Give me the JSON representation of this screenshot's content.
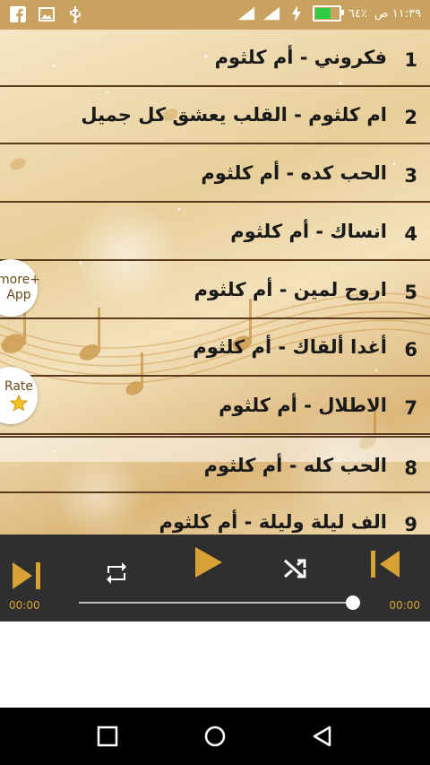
{
  "status_bar": {
    "time": "١١:٣٩ ص",
    "battery_text": "٦٤٪",
    "left_icons": [
      "facebook-icon",
      "image-icon",
      "usb-icon"
    ],
    "right_icons": [
      "signal-icon",
      "signal-icon",
      "charging-icon",
      "battery-icon"
    ]
  },
  "songs": [
    {
      "num": "1",
      "title": "فكروني - أم كلثوم"
    },
    {
      "num": "2",
      "title": "ام كلثوم - القلب يعشق كل جميل"
    },
    {
      "num": "3",
      "title": "الحب كده - أم كلثوم"
    },
    {
      "num": "4",
      "title": "انساك - أم كلثوم"
    },
    {
      "num": "5",
      "title": "اروح لمين - أم كلثوم"
    },
    {
      "num": "6",
      "title": "أغدا ألقاك - أم كلثوم"
    },
    {
      "num": "7",
      "title": "الاطلال - أم كلثوم"
    },
    {
      "num": "8",
      "title": "الحب كله - أم كلثوم"
    },
    {
      "num": "9",
      "title": "الف ليلة وليلة - أم كلثوم"
    }
  ],
  "side_buttons": {
    "more_line1": "more+",
    "more_line2": "App",
    "rate": "Rate"
  },
  "player": {
    "elapsed": "00:00",
    "duration": "00:00",
    "progress": 1.0,
    "accent_color": "#d8a234"
  },
  "nav_icons": [
    "square-recents-icon",
    "circle-home-icon",
    "triangle-back-icon"
  ]
}
